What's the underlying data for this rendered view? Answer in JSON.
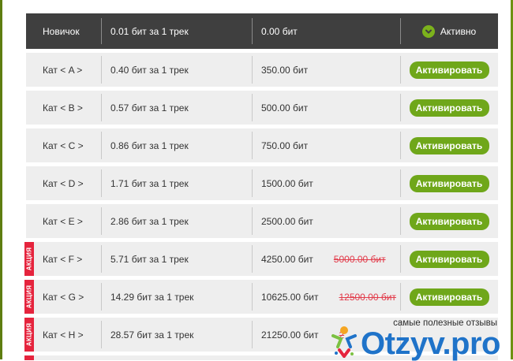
{
  "header": {
    "level": "Новичок",
    "rate": "0.01 бит за 1 трек",
    "cost": "0.00 бит",
    "status": "Активно"
  },
  "rows": [
    {
      "level": "Кат < A >",
      "rate": "0.40 бит за 1 трек",
      "price": "350.00 бит",
      "old_price": "",
      "promo": false,
      "button": "Активировать"
    },
    {
      "level": "Кат < B >",
      "rate": "0.57 бит за 1 трек",
      "price": "500.00 бит",
      "old_price": "",
      "promo": false,
      "button": "Активировать"
    },
    {
      "level": "Кат < C >",
      "rate": "0.86 бит за 1 трек",
      "price": "750.00 бит",
      "old_price": "",
      "promo": false,
      "button": "Активировать"
    },
    {
      "level": "Кат < D >",
      "rate": "1.71 бит за 1 трек",
      "price": "1500.00 бит",
      "old_price": "",
      "promo": false,
      "button": "Активировать"
    },
    {
      "level": "Кат < E >",
      "rate": "2.86 бит за 1 трек",
      "price": "2500.00 бит",
      "old_price": "",
      "promo": false,
      "button": "Активировать"
    },
    {
      "level": "Кат < F >",
      "rate": "5.71 бит за 1 трек",
      "price": "4250.00 бит",
      "old_price": "5000.00 бит",
      "promo": true,
      "badge": "АКЦИЯ",
      "button": "Активировать"
    },
    {
      "level": "Кат < G >",
      "rate": "14.29 бит за 1 трек",
      "price": "10625.00 бит",
      "old_price": "12500.00 бит",
      "promo": true,
      "badge": "АКЦИЯ",
      "button": "Активировать"
    },
    {
      "level": "Кат < H >",
      "rate": "28.57 бит за 1 трек",
      "price": "21250.00 бит",
      "old_price": "2",
      "promo": true,
      "badge": "АКЦИЯ",
      "button": ""
    }
  ],
  "watermark": {
    "tagline": "самые полезные отзывы",
    "logo": "Otzyv.pro"
  },
  "colors": {
    "header_bg": "#3f3f3f",
    "row_bg": "#eeeeee",
    "button_green": "#6fa71a",
    "promo_red": "#e5243d",
    "strike_red": "#e23b4a",
    "logo_blue": "#1f73c9"
  }
}
